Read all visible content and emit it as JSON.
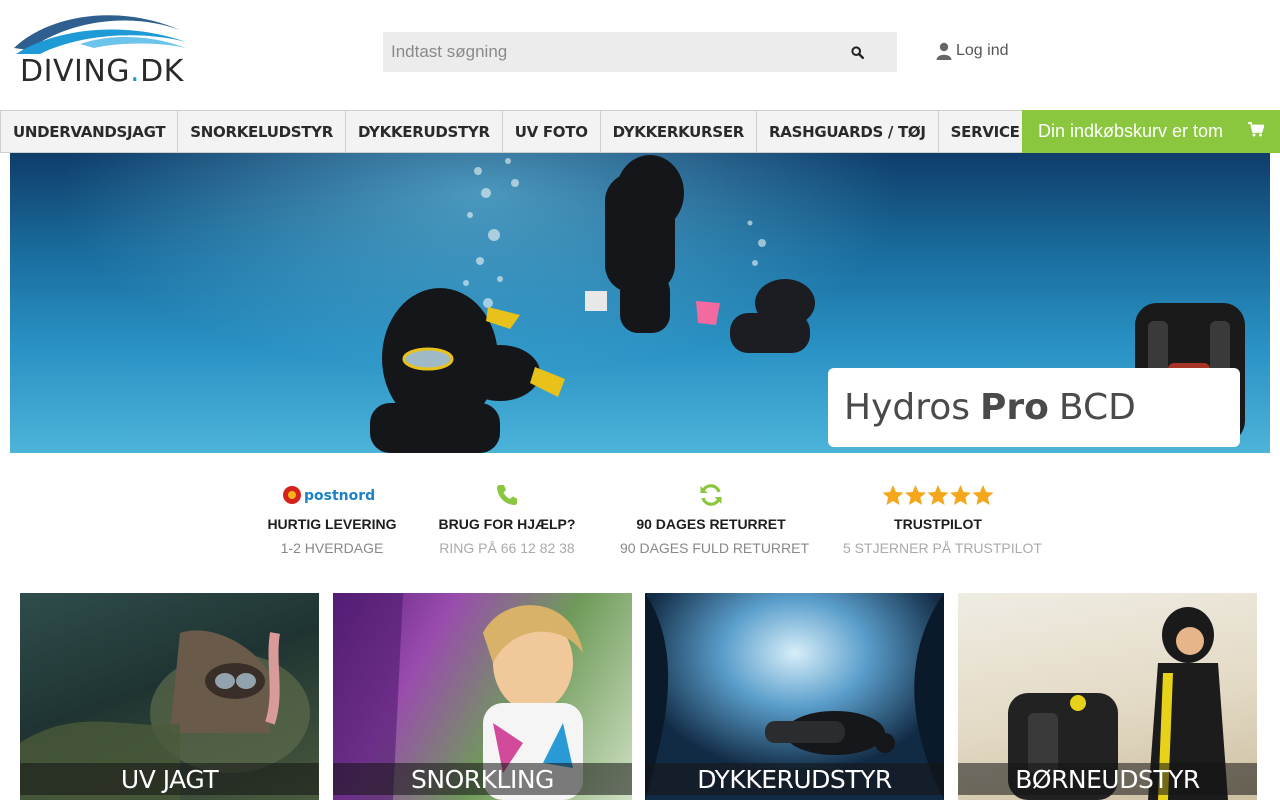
{
  "logo": {
    "text_main": "DIVING",
    "text_dot": ".",
    "text_tld": "DK"
  },
  "search": {
    "placeholder": "Indtast søgning",
    "icon": "search-icon"
  },
  "login": {
    "label": "Log ind",
    "icon": "user-icon"
  },
  "nav": {
    "items": [
      {
        "label": "UNDERVANDSJAGT"
      },
      {
        "label": "SNORKELUDSTYR"
      },
      {
        "label": "DYKKERUDSTYR"
      },
      {
        "label": "UV FOTO"
      },
      {
        "label": "DYKKERKURSER"
      },
      {
        "label": "RASHGUARDS / TØJ"
      },
      {
        "label": "SERVICE & TILLÆG"
      }
    ]
  },
  "cart": {
    "label": "Din indkøbskurv er tom",
    "icon": "shopping-cart-icon",
    "color": "#8bc63f"
  },
  "hero": {
    "product_pre": "Hydros",
    "product_bold": "Pro",
    "product_post": "BCD"
  },
  "usps": [
    {
      "icon": "postnord-logo",
      "logo_text": "postnord",
      "title": "HURTIG LEVERING",
      "subtitle": "1-2 HVERDAGE"
    },
    {
      "icon": "phone-icon",
      "title": "BRUG FOR HJÆLP?",
      "subtitle": "RING PÅ 66 12 82 38"
    },
    {
      "icon": "refresh-icon",
      "title": "90 DAGES RETURRET",
      "subtitle": "90 DAGES FULD RETURRET"
    },
    {
      "icon": "star-icon",
      "rating": 5,
      "title": "TRUSTPILOT",
      "subtitle": "5 STJERNER PÅ TRUSTPILOT"
    }
  ],
  "tiles": [
    {
      "label": "UV JAGT"
    },
    {
      "label": "SNORKLING"
    },
    {
      "label": "DYKKERUDSTYR"
    },
    {
      "label": "BØRNEUDSTYR"
    }
  ],
  "colors": {
    "accent_green": "#8bc63f",
    "logo_blue": "#1e9ad6",
    "logo_navy": "#2f5f8f"
  }
}
